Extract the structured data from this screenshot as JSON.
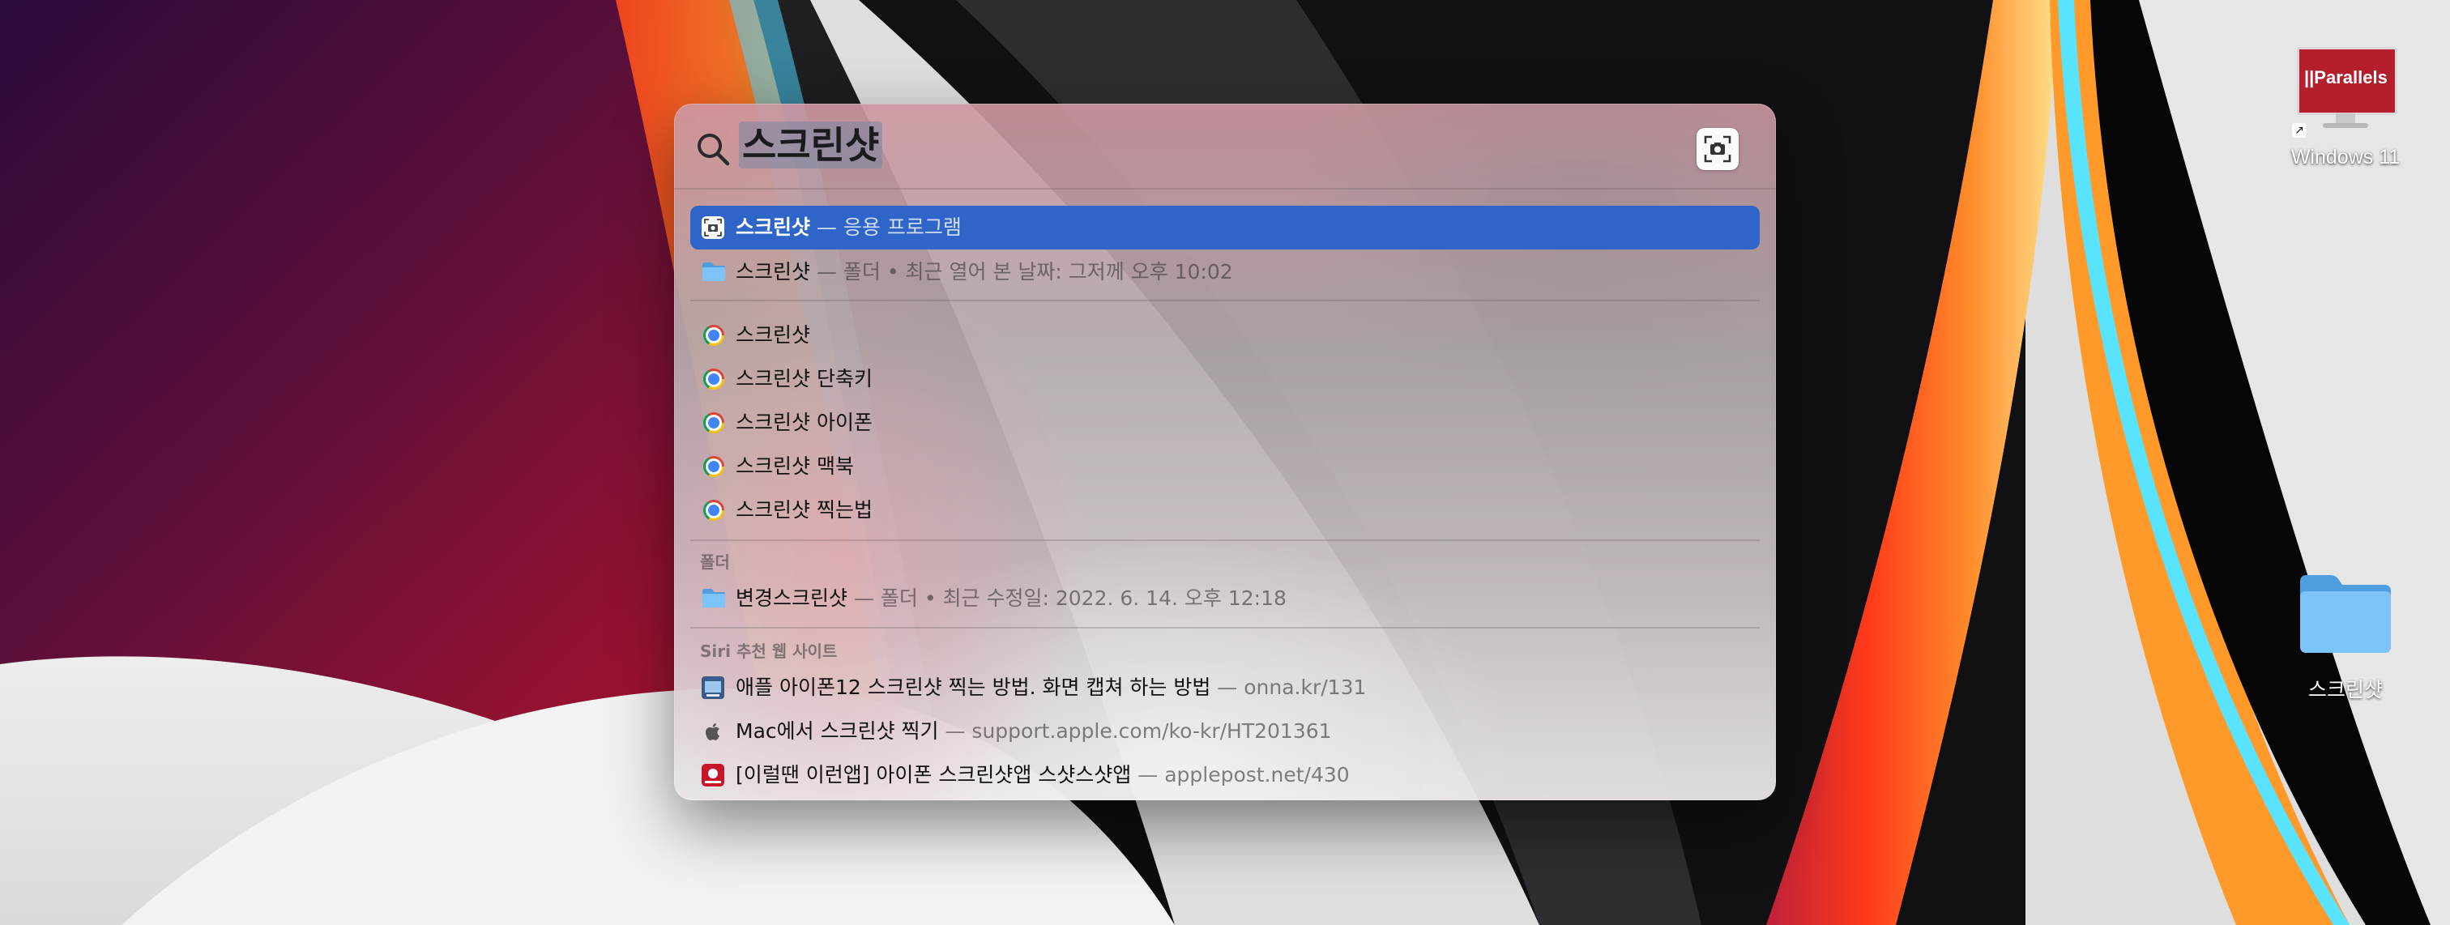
{
  "desktop": {
    "icons": [
      {
        "name": "Windows 11",
        "badge": "||Parallels"
      },
      {
        "name": "스크린샷"
      }
    ]
  },
  "spotlight": {
    "query": "스크린샷",
    "top_hits": [
      {
        "title": "스크린샷",
        "subtitle": " — 응용 프로그램",
        "icon": "screenshot-app-icon",
        "selected": true
      },
      {
        "title": "스크린샷",
        "subtitle": " — 폴더 • 최근 열어 본 날짜: 그저께 오후 10:02",
        "icon": "folder-icon"
      }
    ],
    "suggestions": [
      {
        "title": "스크린샷",
        "icon": "chrome-icon"
      },
      {
        "title": "스크린샷 단축키",
        "icon": "chrome-icon"
      },
      {
        "title": "스크린샷 아이폰",
        "icon": "chrome-icon"
      },
      {
        "title": "스크린샷 맥북",
        "icon": "chrome-icon"
      },
      {
        "title": "스크린샷 찍는법",
        "icon": "chrome-icon"
      }
    ],
    "folders_section": {
      "header": "폴더",
      "items": [
        {
          "title": "변경스크린샷",
          "subtitle": " — 폴더 • 최근 수정일: 2022. 6. 14. 오후 12:18",
          "icon": "folder-icon"
        }
      ]
    },
    "siri_section": {
      "header": "Siri 추천 웹 사이트",
      "items": [
        {
          "title": "애플 아이폰12 스크린샷 찍는 방법. 화면 캡쳐 하는 방법",
          "subtitle": " — onna.kr/131",
          "icon": "website-icon"
        },
        {
          "title": "Mac에서 스크린샷 찍기",
          "subtitle": " — support.apple.com/ko-kr/HT201361",
          "icon": "apple-icon"
        },
        {
          "title": "[이럴땐 이런앱] 아이폰 스크린샷앱 스샷스샷앱",
          "subtitle": " — applepost.net/430",
          "icon": "applepost-icon"
        }
      ]
    }
  },
  "colors": {
    "selection": "#2f64c9",
    "folder_blue": "#6cb6f0"
  }
}
